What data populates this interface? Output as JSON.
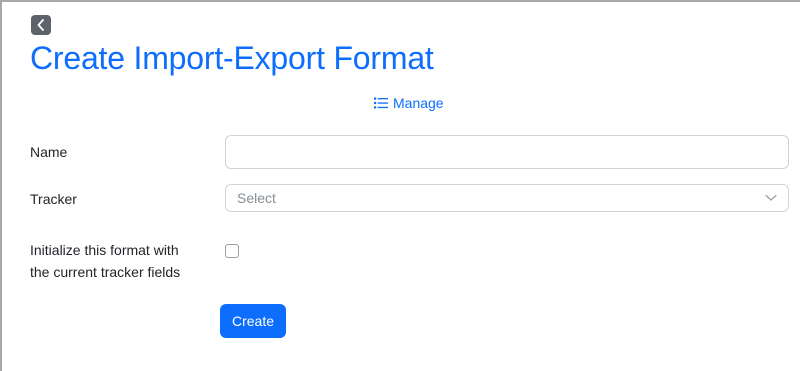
{
  "header": {
    "back_icon": "chevron-left-icon",
    "title": "Create Import-Export Format"
  },
  "manage_link": {
    "icon": "list-icon",
    "label": "Manage"
  },
  "form": {
    "name_label": "Name",
    "name_value": "",
    "tracker_label": "Tracker",
    "tracker_placeholder": "Select",
    "init_label_line1": "Initialize this format with",
    "init_label_line2": "the current tracker fields",
    "init_checked": false,
    "submit_label": "Create"
  },
  "colors": {
    "accent": "#0d6efd",
    "back_button": "#5c636a",
    "border": "#ced4da"
  }
}
